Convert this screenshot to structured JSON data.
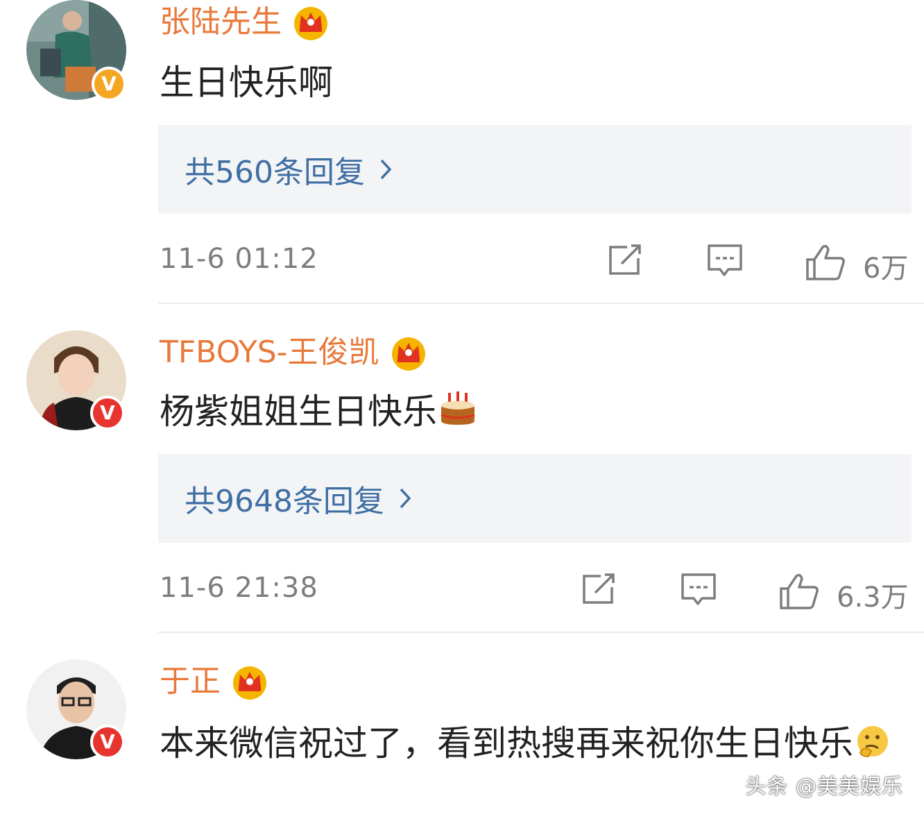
{
  "comments": [
    {
      "username": "张陆先生",
      "text": "生日快乐啊",
      "reply_label": "共560条回复",
      "time": "11-6 01:12",
      "likes": "6万",
      "badge_letter": "V",
      "badge_color": "#f5a623"
    },
    {
      "username": "TFBOYS-王俊凯",
      "text": "杨紫姐姐生日快乐",
      "reply_label": "共9648条回复",
      "time": "11-6 21:38",
      "likes": "6.3万",
      "badge_letter": "V",
      "badge_color": "#e8342f"
    },
    {
      "username": "于正",
      "text": "本来微信祝过了，看到热搜再来祝你生日快乐",
      "badge_letter": "V",
      "badge_color": "#e8342f"
    }
  ],
  "icons": [
    "crown-icon",
    "verified-badge-icon",
    "share-icon",
    "comment-icon",
    "like-icon",
    "chevron-right-icon",
    "cake-emoji-icon",
    "thinking-emoji-icon"
  ],
  "colors": {
    "username": "#e8793a",
    "reply_link": "#3f6ea3",
    "meta": "#7d7d7d",
    "reply_bg": "#f3f4f6"
  },
  "watermark": "头条 @美美娱乐"
}
